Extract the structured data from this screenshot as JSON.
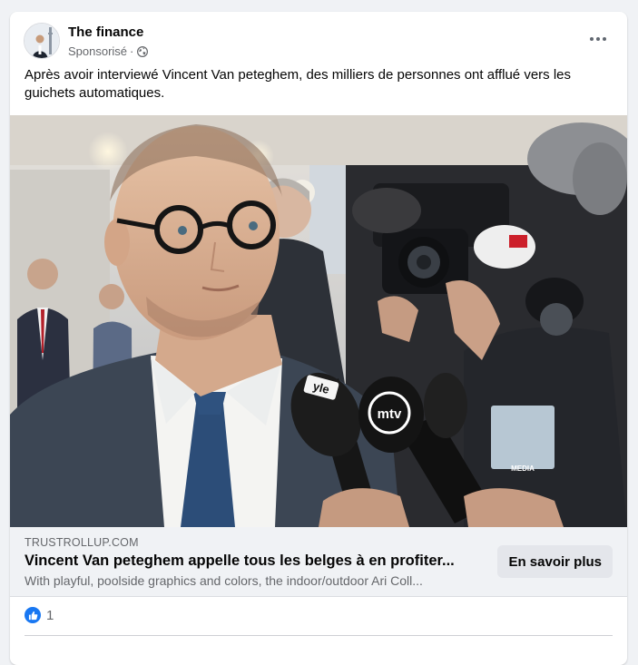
{
  "post": {
    "page_name": "The finance",
    "sponsored_label": "Sponsorisé",
    "meta_separator": "·",
    "privacy_icon": "globe-icon",
    "more_icon": "more-horizontal-icon",
    "text": "Après avoir interviewé Vincent Van peteghem, des milliers de personnes ont afflué vers les guichets automatiques."
  },
  "media": {
    "mic_labels": [
      "yle",
      "mtv"
    ],
    "badge_text": "MEDIA"
  },
  "link": {
    "domain": "TRUSTROLLUP.COM",
    "title": "Vincent Van peteghem appelle tous les belges à en profiter...",
    "description": "With playful, poolside graphics and colors, the indoor/outdoor Ari Coll...",
    "cta_label": "En savoir plus"
  },
  "reactions": {
    "icon": "like-icon",
    "count": "1"
  },
  "colors": {
    "accent": "#1877f2",
    "page_background": "#f0f2f5",
    "card_background": "#ffffff",
    "secondary_text": "#65676b"
  }
}
